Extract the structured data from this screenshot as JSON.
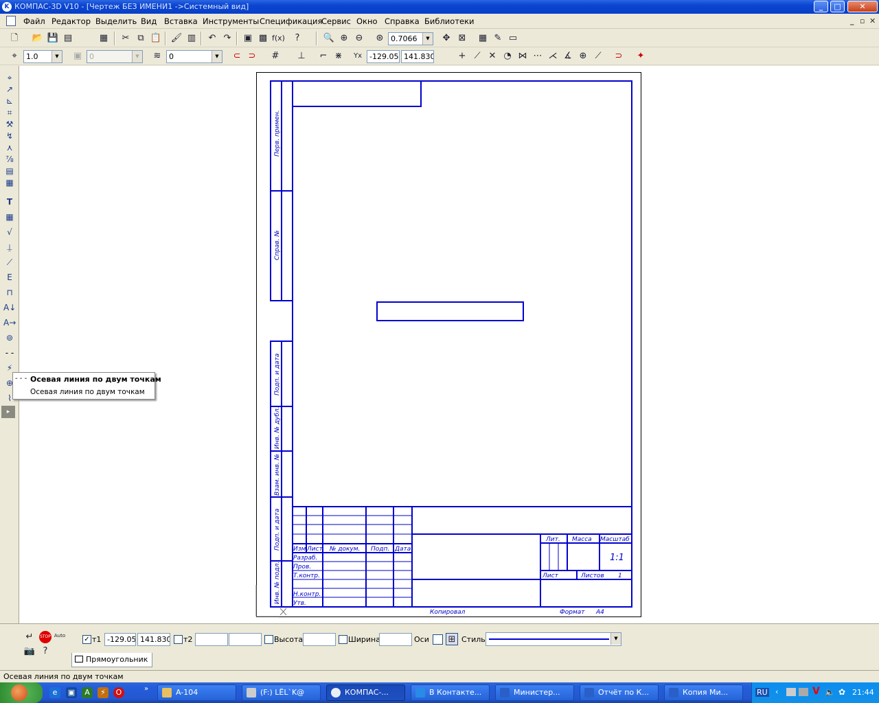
{
  "window": {
    "title": "КОМПАС-3D V10 - [Чертеж БЕЗ ИМЕНИ1 ->Системный вид]",
    "min_label": "_",
    "max_label": "□",
    "close_label": "✕"
  },
  "menu": {
    "items": [
      "Файл",
      "Редактор",
      "Выделить",
      "Вид",
      "Вставка",
      "Инструменты",
      "Спецификация",
      "Сервис",
      "Окно",
      "Справка",
      "Библиотеки"
    ],
    "mdi_min": "_",
    "mdi_restore": "▫",
    "mdi_close": "✕"
  },
  "toolbar_top": {
    "zoom_value": "0.7066"
  },
  "toolbar_current": {
    "step_value": "1.0",
    "layer_state_value": "0",
    "layer_value": "0",
    "coord_x": "-129.05",
    "coord_y": "141.830"
  },
  "drawing": {
    "side_labels": [
      "Перв. примен.",
      "Справ. №",
      "Подп. и дата",
      "Инв. № дубл.",
      "Взам. инв. №",
      "Подп. и дата",
      "Инв. № подл."
    ],
    "title_block": {
      "col_headers": [
        "Изм",
        "Лист",
        "№ докум.",
        "Подп.",
        "Дата"
      ],
      "row_labels": [
        "Разраб.",
        "Пров.",
        "Т.контр.",
        "",
        "Н.контр.",
        "Утв."
      ],
      "lit": "Лит.",
      "massa": "Масса",
      "masshtab": "Масштаб",
      "scale_value": "1:1",
      "list": "Лист",
      "listov": "Листов",
      "listov_value": "1",
      "kopiroval": "Копировал",
      "format": "Формат",
      "format_value": "A4"
    }
  },
  "tooltip": {
    "title": "Осевая линия по двум точкам",
    "subtitle": "Осевая линия по двум точкам"
  },
  "properties": {
    "t1_label": "т1",
    "t1_x": "-129.05",
    "t1_y": "141.830",
    "t2_label": "т2",
    "height_label": "Высота",
    "width_label": "Ширина",
    "axes_label": "Оси",
    "style_label": "Стиль",
    "tab_label": "Прямоугольник"
  },
  "status": {
    "text": "Осевая линия по двум точкам"
  },
  "taskbar": {
    "tasks": [
      "A-104",
      "(F:) LËL`K@",
      "КОМПАС-...",
      "В Контакте...",
      "Министер...",
      "Отчёт по К...",
      "Копия Ми..."
    ],
    "lang": "RU",
    "clock": "21:44"
  },
  "colors": {
    "drawing_frame": "#0000cc",
    "titlebar": "#0a44d0",
    "taskbar": "#245edb"
  }
}
